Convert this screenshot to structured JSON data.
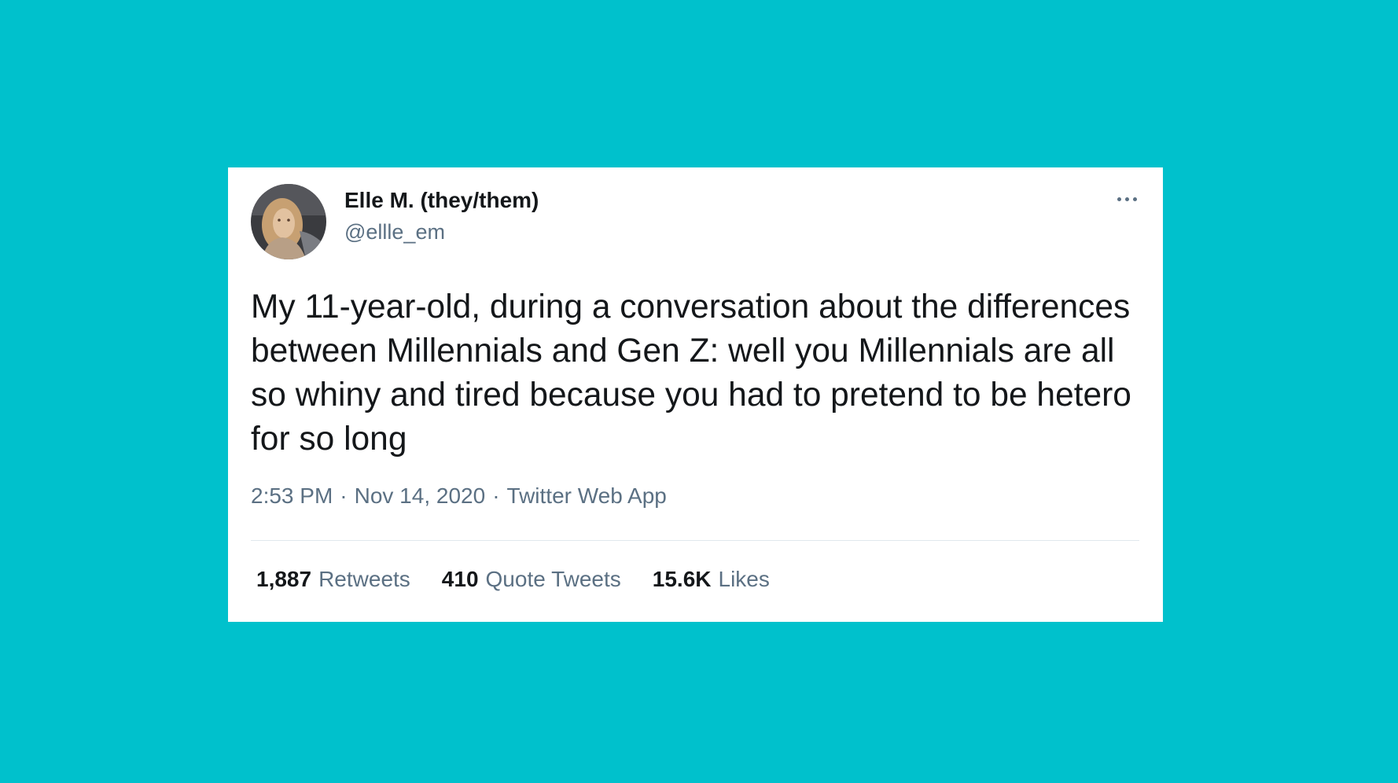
{
  "tweet": {
    "author": {
      "display_name": "Elle M. (they/them)",
      "handle": "@ellle_em"
    },
    "text": "My 11-year-old, during a conversation about the differences between Millennials and Gen Z: well you Millennials are all so whiny and tired because you had to pretend to be hetero for so long",
    "time": "2:53 PM",
    "date": "Nov 14, 2020",
    "source": "Twitter Web App",
    "separator": "·",
    "stats": {
      "retweets": {
        "count": "1,887",
        "label": "Retweets"
      },
      "quote_tweets": {
        "count": "410",
        "label": "Quote Tweets"
      },
      "likes": {
        "count": "15.6K",
        "label": "Likes"
      }
    }
  },
  "icons": {
    "more": "more-options-icon",
    "avatar": "profile-photo"
  },
  "colors": {
    "background": "#00c1cc",
    "card": "#ffffff",
    "primary_text": "#14171a",
    "secondary_text": "#5b7083",
    "divider": "#e1e8ed"
  }
}
